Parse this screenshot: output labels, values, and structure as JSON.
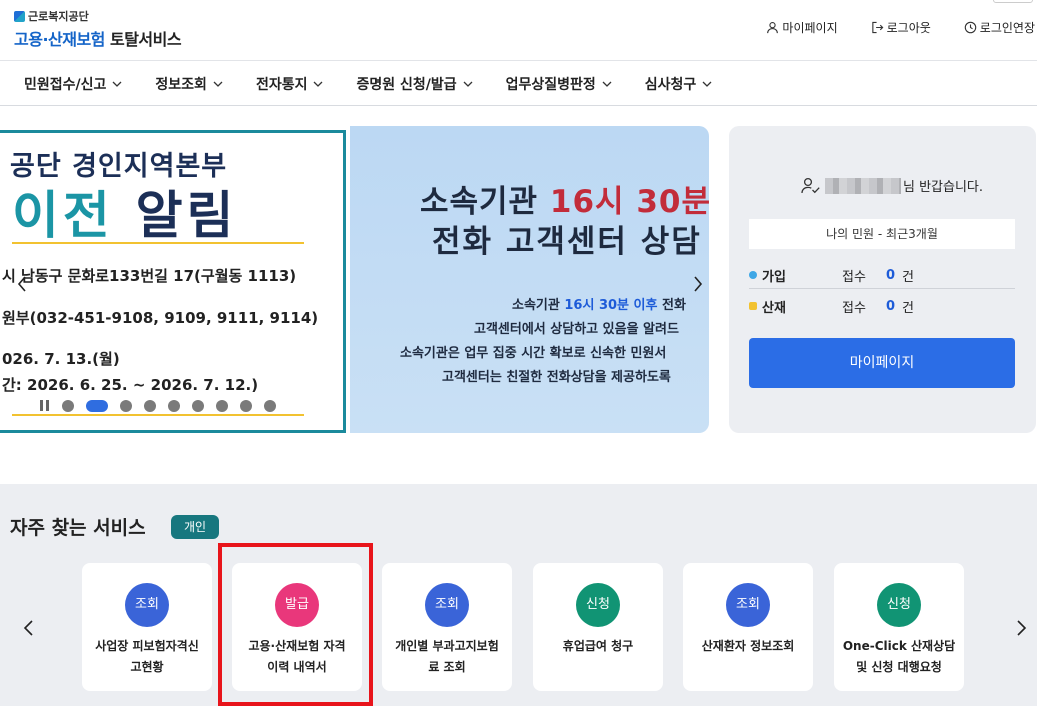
{
  "header": {
    "logo_sub": "근로복지공단",
    "logo_main_blue": "고용·산재보험",
    "logo_main_dark": "토탈서비스",
    "util": [
      {
        "label": "마이페이지",
        "icon": "person-icon"
      },
      {
        "label": "로그아웃",
        "icon": "logout-icon"
      },
      {
        "label": "로그인연장",
        "icon": "clock-icon"
      }
    ]
  },
  "gnb": [
    {
      "label": "민원접수/신고"
    },
    {
      "label": "정보조회"
    },
    {
      "label": "전자통지"
    },
    {
      "label": "증명원 신청/발급"
    },
    {
      "label": "업무상질병판정"
    },
    {
      "label": "심사청구"
    }
  ],
  "banner": {
    "slide1": {
      "title": "공단 경인지역본부",
      "big_teal": "이전",
      "big_navy": "알림",
      "lines": [
        "시 남동구 문화로133번길 17(구월동 1113)",
        "원부(032-451-9108, 9109, 9111, 9114)",
        "026. 7. 13.(월)",
        "간: 2026. 6. 25. ~ 2026. 7. 12.)"
      ]
    },
    "slide2": {
      "h1_pre": "소속기관 ",
      "h1_red": "16시 30분",
      "h2": "전화 고객센터 상담",
      "p1_pre": "소속기관 ",
      "p1_blue": "16시 30분 이후",
      "p1_post": " 전화",
      "p2": "고객센터에서 상담하고 있음을 알려드",
      "p3": "소속기관은 업무 집중 시간 확보로 신속한 민원서",
      "p4": "고객센터는 친절한 전화상담을 제공하도록"
    },
    "dot_count": 9,
    "active_dot": 1
  },
  "panel": {
    "greeting": "님 반갑습니다.",
    "recent_label": "나의 민원 - 최근3개월",
    "rows": [
      {
        "label": "가입",
        "status": "접수",
        "count": "0",
        "unit": "건",
        "color": "#3ea7e6"
      },
      {
        "label": "산재",
        "status": "접수",
        "count": "0",
        "unit": "건",
        "color": "#f2c230"
      }
    ],
    "button": "마이페이지"
  },
  "services": {
    "title": "자주 찾는 서비스",
    "badge": "개인",
    "cards": [
      {
        "type": "조회",
        "color": "#3a64d8",
        "line1": "사업장 피보험자격신",
        "line2": "고현황"
      },
      {
        "type": "발급",
        "color": "#e9377b",
        "line1": "고용·산재보험 자격",
        "line2": "이력 내역서"
      },
      {
        "type": "조회",
        "color": "#3a64d8",
        "line1": "개인별 부과고지보험",
        "line2": "료 조회"
      },
      {
        "type": "신청",
        "color": "#119474",
        "line1": "휴업급여 청구",
        "line2": ""
      },
      {
        "type": "조회",
        "color": "#3a64d8",
        "line1": "산재환자 정보조회",
        "line2": ""
      },
      {
        "type": "신청",
        "color": "#119474",
        "line1": "One-Click 산재상담",
        "line2": "및 신청 대행요청"
      }
    ]
  }
}
